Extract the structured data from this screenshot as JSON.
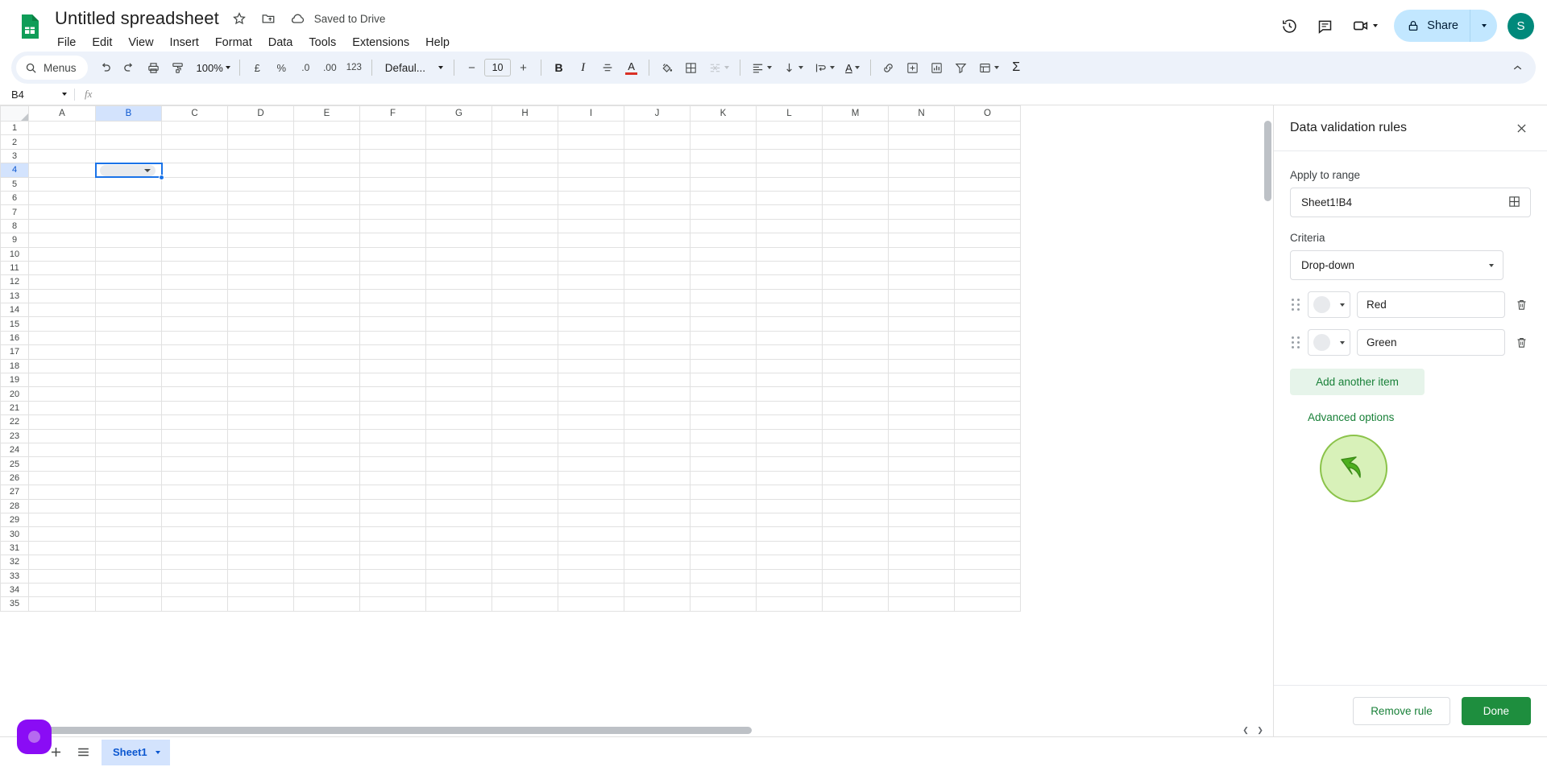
{
  "header": {
    "doc_title": "Untitled spreadsheet",
    "save_status": "Saved to Drive",
    "star_icon": "star-icon",
    "move_icon": "move-to-folder-icon",
    "cloud_icon": "cloud-saved-icon",
    "menus": [
      "File",
      "Edit",
      "View",
      "Insert",
      "Format",
      "Data",
      "Tools",
      "Extensions",
      "Help"
    ],
    "history_icon": "version-history-icon",
    "comment_icon": "comment-icon",
    "meet_icon": "video-camera-icon",
    "share_label": "Share",
    "share_lock_icon": "lock-icon",
    "avatar_initial": "S"
  },
  "toolbar": {
    "menus_label": "Menus",
    "search_icon": "search-icon",
    "undo_icon": "undo-icon",
    "redo_icon": "redo-icon",
    "print_icon": "print-icon",
    "paint_icon": "paint-format-icon",
    "zoom_value": "100%",
    "currency_label": "£",
    "percent_label": "%",
    "decimal_dec_label": ".0",
    "decimal_inc_label": ".00",
    "more_formats_label": "123",
    "font_name": "Defaul...",
    "font_size": "10",
    "decrease_size": "−",
    "increase_size": "+",
    "bold_label": "B",
    "italic_label": "I",
    "strike_icon": "strikethrough-icon",
    "text_color_label": "A",
    "fill_color_icon": "fill-color-icon",
    "borders_icon": "borders-icon",
    "merge_icon": "merge-cells-icon",
    "halign_icon": "horizontal-align-icon",
    "valign_icon": "vertical-align-icon",
    "wrap_icon": "text-wrapping-icon",
    "rotate_label": "A",
    "link_icon": "insert-link-icon",
    "comment_icon": "insert-comment-icon",
    "chart_icon": "insert-chart-icon",
    "filter_icon": "filter-icon",
    "functions_icon": "functions-icon",
    "sigma_label": "Σ",
    "collapse_icon": "collapse-toolbar-icon"
  },
  "formula_bar": {
    "name_box": "B4",
    "fx_label": "fx",
    "formula_value": ""
  },
  "grid": {
    "columns": [
      "A",
      "B",
      "C",
      "D",
      "E",
      "F",
      "G",
      "H",
      "I",
      "J",
      "K",
      "L",
      "M",
      "N",
      "O"
    ],
    "selected_column": "B",
    "selected_row": 4,
    "selected_cell": "B4",
    "rows": [
      1,
      2,
      3,
      4,
      5,
      6,
      7,
      8,
      9,
      10,
      11,
      12,
      13,
      14,
      15,
      16,
      17,
      18,
      19,
      20,
      21,
      22,
      23,
      24,
      25,
      26,
      27,
      28,
      29,
      30,
      31,
      32,
      33,
      34,
      35
    ],
    "cell_dropdown_chip": true
  },
  "panel": {
    "title": "Data validation rules",
    "close_icon": "close-icon",
    "apply_label": "Apply to range",
    "range_value": "Sheet1!B4",
    "range_picker_icon": "select-data-range-icon",
    "criteria_label": "Criteria",
    "criteria_value": "Drop-down",
    "criteria_caret_icon": "chevron-down-icon",
    "items": [
      {
        "value": "Red",
        "swatch_color": "#e8eaed",
        "drag_icon": "drag-handle-icon",
        "delete_icon": "trash-icon"
      },
      {
        "value": "Green",
        "swatch_color": "#e8eaed",
        "drag_icon": "drag-handle-icon",
        "delete_icon": "trash-icon"
      }
    ],
    "add_item_label": "Add another item",
    "advanced_label": "Advanced options",
    "remove_label": "Remove rule",
    "done_label": "Done",
    "accent_green": "#188038",
    "done_bg": "#1e8e3e",
    "collapse_icon": "collapse-panel-icon"
  },
  "bottom": {
    "add_sheet_icon": "add-sheet-icon",
    "all_sheets_icon": "all-sheets-icon",
    "sheet_name": "Sheet1",
    "sheet_caret_icon": "chevron-down-icon",
    "recording_indicator": "recording-indicator"
  }
}
